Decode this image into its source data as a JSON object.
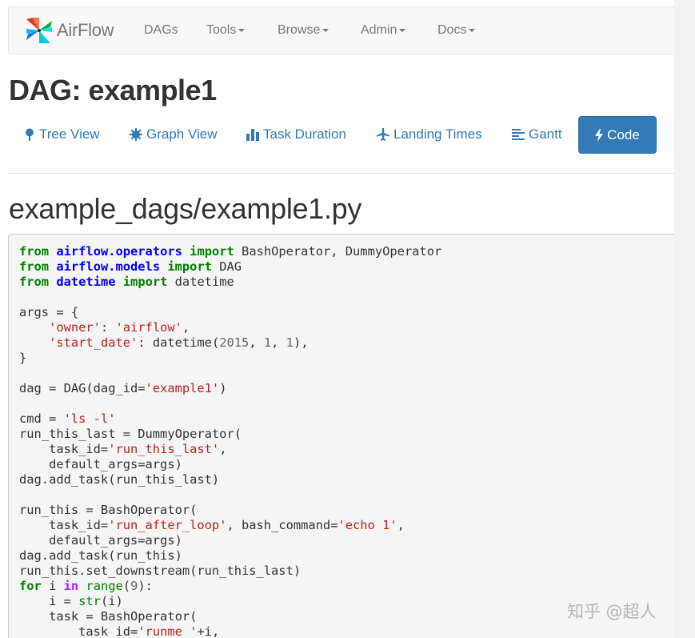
{
  "navbar": {
    "brand": "AirFlow",
    "items": [
      {
        "label": "DAGs",
        "dropdown": false
      },
      {
        "label": "Tools",
        "dropdown": true
      },
      {
        "label": "Browse",
        "dropdown": true
      },
      {
        "label": "Admin",
        "dropdown": true
      },
      {
        "label": "Docs",
        "dropdown": true
      }
    ]
  },
  "page": {
    "title": "DAG: example1",
    "file_title": "example_dags/example1.py"
  },
  "views": {
    "tabs": [
      {
        "label": "Tree View",
        "icon": "tree-icon"
      },
      {
        "label": "Graph View",
        "icon": "asterisk-icon"
      },
      {
        "label": "Task Duration",
        "icon": "bar-chart-icon"
      },
      {
        "label": "Landing Times",
        "icon": "plane-icon"
      },
      {
        "label": "Gantt",
        "icon": "align-left-icon"
      }
    ],
    "active": {
      "label": "Code",
      "icon": "bolt-icon"
    }
  },
  "colors": {
    "link": "#337ab7",
    "active_button": "#337ab7",
    "keyword": "#008000",
    "module": "#0000ff",
    "string": "#ba2121",
    "number": "#666666",
    "operator_word": "#aa22ff"
  },
  "code_lines": [
    [
      {
        "t": "kw",
        "v": "from"
      },
      {
        "t": "plain",
        "v": " "
      },
      {
        "t": "mod",
        "v": "airflow.operators"
      },
      {
        "t": "plain",
        "v": " "
      },
      {
        "t": "kw",
        "v": "import"
      },
      {
        "t": "plain",
        "v": " BashOperator, DummyOperator"
      }
    ],
    [
      {
        "t": "kw",
        "v": "from"
      },
      {
        "t": "plain",
        "v": " "
      },
      {
        "t": "mod",
        "v": "airflow.models"
      },
      {
        "t": "plain",
        "v": " "
      },
      {
        "t": "kw",
        "v": "import"
      },
      {
        "t": "plain",
        "v": " DAG"
      }
    ],
    [
      {
        "t": "kw",
        "v": "from"
      },
      {
        "t": "plain",
        "v": " "
      },
      {
        "t": "mod",
        "v": "datetime"
      },
      {
        "t": "plain",
        "v": " "
      },
      {
        "t": "kw",
        "v": "import"
      },
      {
        "t": "plain",
        "v": " datetime"
      }
    ],
    [],
    [
      {
        "t": "plain",
        "v": "args = {"
      }
    ],
    [
      {
        "t": "plain",
        "v": "    "
      },
      {
        "t": "str",
        "v": "'owner'"
      },
      {
        "t": "plain",
        "v": ": "
      },
      {
        "t": "str",
        "v": "'airflow'"
      },
      {
        "t": "plain",
        "v": ","
      }
    ],
    [
      {
        "t": "plain",
        "v": "    "
      },
      {
        "t": "str",
        "v": "'start_date'"
      },
      {
        "t": "plain",
        "v": ": datetime("
      },
      {
        "t": "num",
        "v": "2015"
      },
      {
        "t": "plain",
        "v": ", "
      },
      {
        "t": "num",
        "v": "1"
      },
      {
        "t": "plain",
        "v": ", "
      },
      {
        "t": "num",
        "v": "1"
      },
      {
        "t": "plain",
        "v": "),"
      }
    ],
    [
      {
        "t": "plain",
        "v": "}"
      }
    ],
    [],
    [
      {
        "t": "plain",
        "v": "dag = DAG(dag_id="
      },
      {
        "t": "str",
        "v": "'example1'"
      },
      {
        "t": "plain",
        "v": ")"
      }
    ],
    [],
    [
      {
        "t": "plain",
        "v": "cmd = "
      },
      {
        "t": "str",
        "v": "'ls -l'"
      }
    ],
    [
      {
        "t": "plain",
        "v": "run_this_last = DummyOperator("
      }
    ],
    [
      {
        "t": "plain",
        "v": "    task_id="
      },
      {
        "t": "str",
        "v": "'run_this_last'"
      },
      {
        "t": "plain",
        "v": ","
      }
    ],
    [
      {
        "t": "plain",
        "v": "    default_args=args)"
      }
    ],
    [
      {
        "t": "plain",
        "v": "dag.add_task(run_this_last)"
      }
    ],
    [],
    [
      {
        "t": "plain",
        "v": "run_this = BashOperator("
      }
    ],
    [
      {
        "t": "plain",
        "v": "    task_id="
      },
      {
        "t": "str",
        "v": "'run_after_loop'"
      },
      {
        "t": "plain",
        "v": ", bash_command="
      },
      {
        "t": "str",
        "v": "'echo 1'"
      },
      {
        "t": "plain",
        "v": ","
      }
    ],
    [
      {
        "t": "plain",
        "v": "    default_args=args)"
      }
    ],
    [
      {
        "t": "plain",
        "v": "dag.add_task(run_this)"
      }
    ],
    [
      {
        "t": "plain",
        "v": "run_this.set_downstream(run_this_last)"
      }
    ],
    [
      {
        "t": "kw",
        "v": "for"
      },
      {
        "t": "plain",
        "v": " i "
      },
      {
        "t": "op",
        "v": "in"
      },
      {
        "t": "plain",
        "v": " "
      },
      {
        "t": "bi",
        "v": "range"
      },
      {
        "t": "plain",
        "v": "("
      },
      {
        "t": "num",
        "v": "9"
      },
      {
        "t": "plain",
        "v": "):"
      }
    ],
    [
      {
        "t": "plain",
        "v": "    i = "
      },
      {
        "t": "bi",
        "v": "str"
      },
      {
        "t": "plain",
        "v": "(i)"
      }
    ],
    [
      {
        "t": "plain",
        "v": "    task = BashOperator("
      }
    ],
    [
      {
        "t": "plain",
        "v": "        task_id="
      },
      {
        "t": "str",
        "v": "'runme_'"
      },
      {
        "t": "plain",
        "v": "+i,"
      }
    ]
  ],
  "watermark": "知乎 @超人"
}
